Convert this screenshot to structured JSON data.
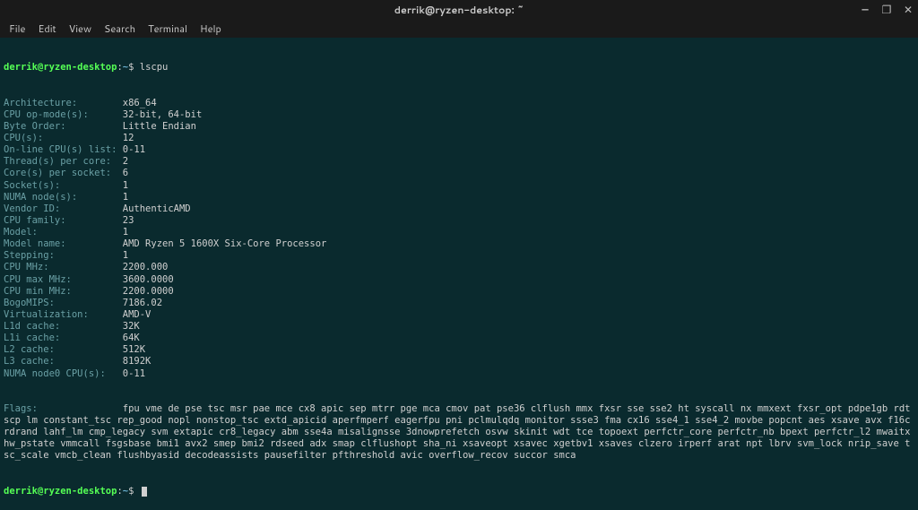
{
  "window": {
    "title": "derrik@ryzen-desktop: ~",
    "controls": {
      "min": "–",
      "max": "❐",
      "close": "✕"
    }
  },
  "menu": {
    "file": "File",
    "edit": "Edit",
    "view": "View",
    "search": "Search",
    "terminal": "Terminal",
    "help": "Help"
  },
  "prompt": {
    "user_host": "derrik@ryzen-desktop",
    "sep": ":",
    "path": "~",
    "symbol": "$"
  },
  "command": "lscpu",
  "lscpu": {
    "rows": [
      {
        "label": "Architecture:",
        "value": "x86_64"
      },
      {
        "label": "CPU op-mode(s):",
        "value": "32-bit, 64-bit"
      },
      {
        "label": "Byte Order:",
        "value": "Little Endian"
      },
      {
        "label": "CPU(s):",
        "value": "12"
      },
      {
        "label": "On-line CPU(s) list:",
        "value": "0-11"
      },
      {
        "label": "Thread(s) per core:",
        "value": "2"
      },
      {
        "label": "Core(s) per socket:",
        "value": "6"
      },
      {
        "label": "Socket(s):",
        "value": "1"
      },
      {
        "label": "NUMA node(s):",
        "value": "1"
      },
      {
        "label": "Vendor ID:",
        "value": "AuthenticAMD"
      },
      {
        "label": "CPU family:",
        "value": "23"
      },
      {
        "label": "Model:",
        "value": "1"
      },
      {
        "label": "Model name:",
        "value": "AMD Ryzen 5 1600X Six-Core Processor"
      },
      {
        "label": "Stepping:",
        "value": "1"
      },
      {
        "label": "CPU MHz:",
        "value": "2200.000"
      },
      {
        "label": "CPU max MHz:",
        "value": "3600.0000"
      },
      {
        "label": "CPU min MHz:",
        "value": "2200.0000"
      },
      {
        "label": "BogoMIPS:",
        "value": "7186.02"
      },
      {
        "label": "Virtualization:",
        "value": "AMD-V"
      },
      {
        "label": "L1d cache:",
        "value": "32K"
      },
      {
        "label": "L1i cache:",
        "value": "64K"
      },
      {
        "label": "L2 cache:",
        "value": "512K"
      },
      {
        "label": "L3 cache:",
        "value": "8192K"
      },
      {
        "label": "NUMA node0 CPU(s):",
        "value": "0-11"
      }
    ],
    "flags_label": "Flags:",
    "flags_value": "fpu vme de pse tsc msr pae mce cx8 apic sep mtrr pge mca cmov pat pse36 clflush mmx fxsr sse sse2 ht syscall nx mmxext fxsr_opt pdpe1gb rdtscp lm constant_tsc rep_good nopl nonstop_tsc extd_apicid aperfmperf eagerfpu pni pclmulqdq monitor ssse3 fma cx16 sse4_1 sse4_2 movbe popcnt aes xsave avx f16c rdrand lahf_lm cmp_legacy svm extapic cr8_legacy abm sse4a misalignsse 3dnowprefetch osvw skinit wdt tce topoext perfctr_core perfctr_nb bpext perfctr_l2 mwaitx hw_pstate vmmcall fsgsbase bmi1 avx2 smep bmi2 rdseed adx smap clflushopt sha_ni xsaveopt xsavec xgetbv1 xsaves clzero irperf arat npt lbrv svm_lock nrip_save tsc_scale vmcb_clean flushbyasid decodeassists pausefilter pfthreshold avic overflow_recov succor smca"
  },
  "colors": {
    "bg": "#0a2a2e",
    "menubg": "#1a1a1a",
    "prompt_green": "#55ff55",
    "prompt_blue": "#6ab0d0",
    "text_dim": "#6aa0a5",
    "text": "#d0d0d0"
  }
}
